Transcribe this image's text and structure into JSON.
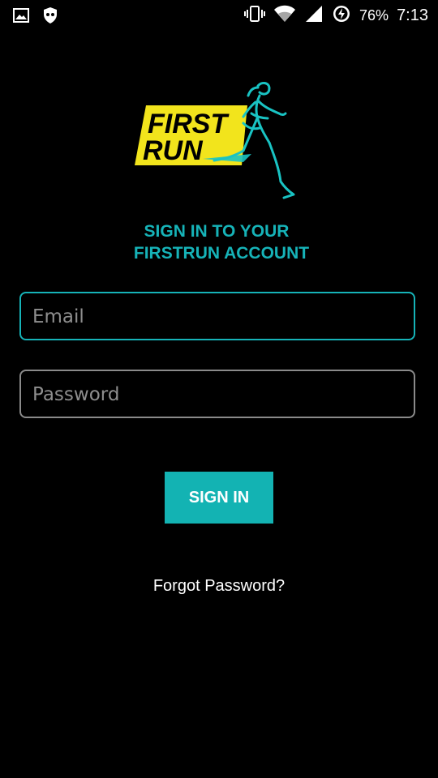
{
  "status_bar": {
    "left_icons": [
      "image-icon",
      "shield-icon"
    ],
    "right_icons": [
      "vibrate-icon",
      "wifi-icon",
      "signal-icon",
      "battery-charging-icon"
    ],
    "battery": "76%",
    "time": "7:13"
  },
  "logo": {
    "text_line1": "FIRST",
    "text_line2": "RUN",
    "colors": {
      "yellow": "#f2e41c",
      "teal": "#19c3c3"
    }
  },
  "heading": {
    "line1": "SIGN IN TO YOUR",
    "line2": "FIRSTRUN ACCOUNT"
  },
  "form": {
    "email_placeholder": "Email",
    "email_value": "",
    "password_placeholder": "Password",
    "password_value": ""
  },
  "buttons": {
    "sign_in": "SIGN IN",
    "forgot_password": "Forgot Password?"
  },
  "colors": {
    "accent": "#16b3b8",
    "background": "#000000"
  }
}
